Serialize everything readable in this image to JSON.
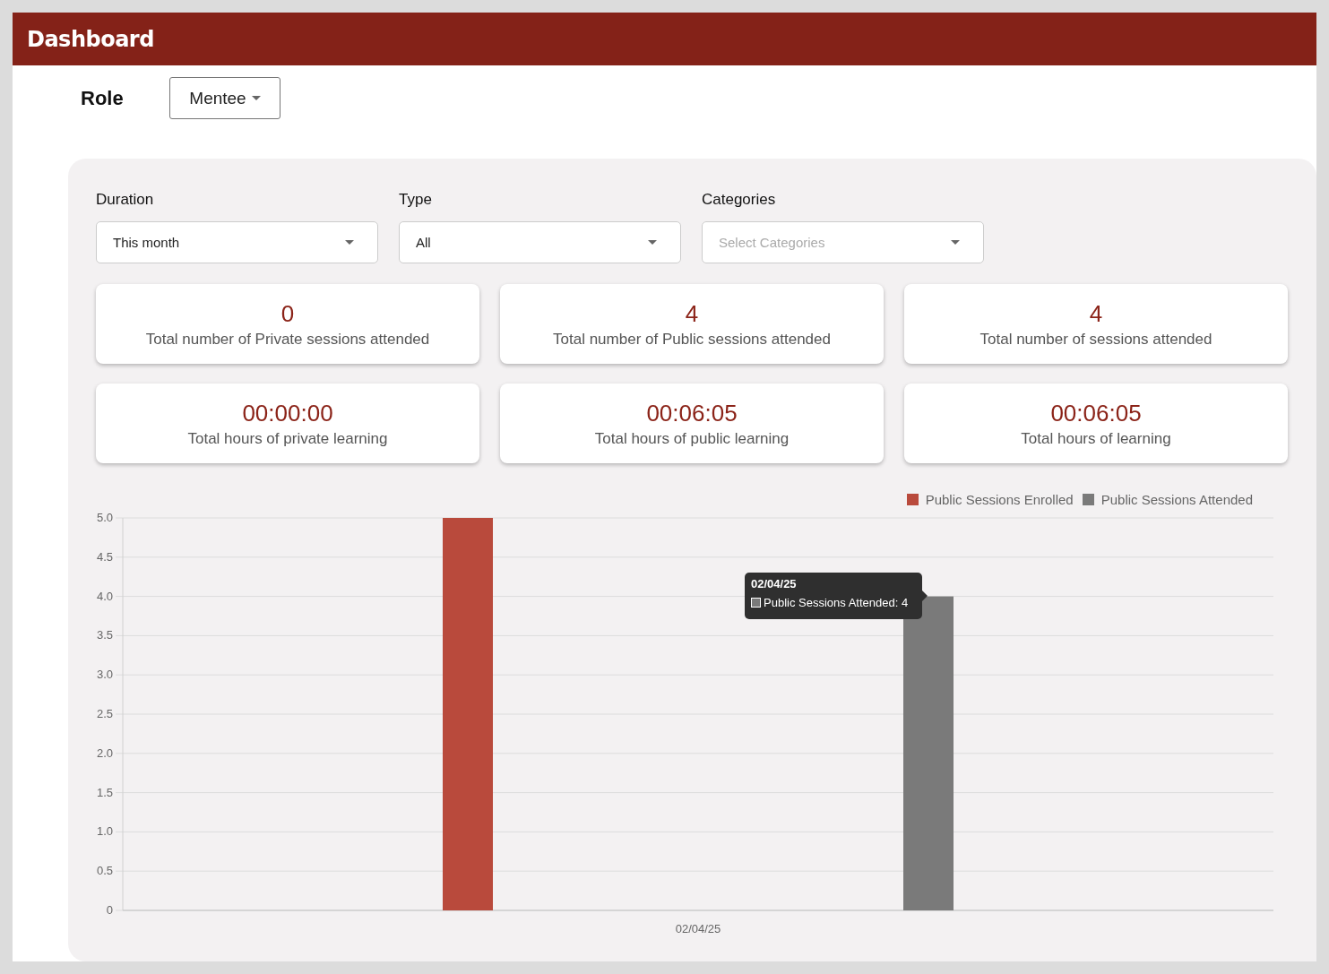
{
  "header": {
    "title": "Dashboard"
  },
  "role": {
    "label": "Role",
    "value": "Mentee"
  },
  "filters": [
    {
      "label": "Duration",
      "value": "This month"
    },
    {
      "label": "Type",
      "value": "All"
    },
    {
      "label": "Categories",
      "placeholder": "Select Categories"
    }
  ],
  "stats": [
    {
      "value": "0",
      "label": "Total number of Private sessions attended"
    },
    {
      "value": "4",
      "label": "Total number of Public sessions attended"
    },
    {
      "value": "4",
      "label": "Total number of sessions attended"
    },
    {
      "value": "00:00:00",
      "label": "Total hours of private learning"
    },
    {
      "value": "00:06:05",
      "label": "Total hours of public learning"
    },
    {
      "value": "00:06:05",
      "label": "Total hours of learning"
    }
  ],
  "chart": {
    "chart_data": {
      "type": "bar",
      "categories": [
        "02/04/25"
      ],
      "series": [
        {
          "name": "Public Sessions Enrolled",
          "color": "#b94a3c",
          "values": [
            5
          ]
        },
        {
          "name": "Public Sessions Attended",
          "color": "#7a7a7a",
          "values": [
            4
          ]
        }
      ],
      "ylim": [
        0,
        5
      ],
      "grid": true,
      "yticks": [
        0,
        {
          "value": 0.5,
          "label": "0.5"
        },
        {
          "value": 1,
          "label": "1.0"
        },
        {
          "value": 1.5,
          "label": "1.5"
        },
        {
          "value": 2,
          "label": "2.0"
        },
        {
          "value": 2.5,
          "label": "2.5"
        },
        {
          "value": 3,
          "label": "3.0"
        },
        {
          "value": 3.5,
          "label": "3.5"
        },
        {
          "value": 4,
          "label": "4.0"
        },
        {
          "value": 4.5,
          "label": "4.5"
        },
        {
          "value": 5,
          "label": "5.0"
        }
      ]
    },
    "tooltip": {
      "title": "02/04/25",
      "text": "Public Sessions Attended: 4"
    }
  }
}
